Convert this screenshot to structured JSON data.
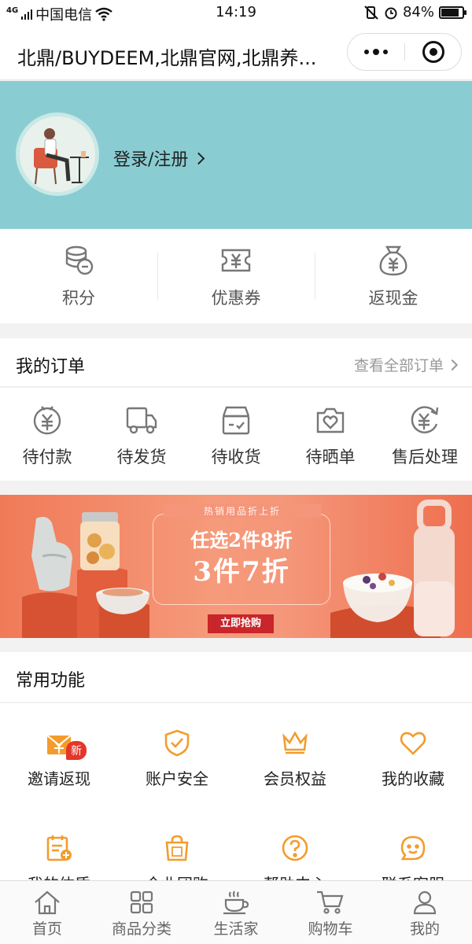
{
  "status_bar": {
    "network": "4G",
    "carrier": "中国电信",
    "time": "14:19",
    "battery_text": "84%",
    "battery_level": 0.84
  },
  "title_bar": {
    "title": "北鼎/BUYDEEM,北鼎官网,北鼎养..."
  },
  "profile": {
    "login_label": "登录/注册",
    "bg_color": "#89cdd3"
  },
  "wallet": [
    {
      "label": "积分",
      "icon": "coins-icon"
    },
    {
      "label": "优惠券",
      "icon": "coupon-icon"
    },
    {
      "label": "返现金",
      "icon": "money-bag-icon"
    }
  ],
  "orders": {
    "title": "我的订单",
    "view_all": "查看全部订单",
    "items": [
      {
        "label": "待付款",
        "icon": "yen-circle-icon"
      },
      {
        "label": "待发货",
        "icon": "truck-icon"
      },
      {
        "label": "待收货",
        "icon": "box-icon"
      },
      {
        "label": "待晒单",
        "icon": "camera-heart-icon"
      },
      {
        "label": "售后处理",
        "icon": "refund-icon"
      }
    ]
  },
  "banner": {
    "tagline": "热销用品折上折",
    "line1": "任选2件8折",
    "line2": "3件7折",
    "button": "立即抢购"
  },
  "functions": {
    "title": "常用功能",
    "accent_color": "#f39c2c",
    "items": [
      {
        "label": "邀请返现",
        "icon": "invite-gift-icon",
        "badge": "新"
      },
      {
        "label": "账户安全",
        "icon": "shield-check-icon"
      },
      {
        "label": "会员权益",
        "icon": "crown-icon"
      },
      {
        "label": "我的收藏",
        "icon": "heart-icon"
      },
      {
        "label": "我的体质",
        "icon": "notepad-plus-icon"
      },
      {
        "label": "企业团购",
        "icon": "shopping-bag-icon"
      },
      {
        "label": "帮助中心",
        "icon": "question-icon"
      },
      {
        "label": "联系客服",
        "icon": "chat-face-icon"
      }
    ]
  },
  "tab_bar": [
    {
      "label": "首页",
      "icon": "home-icon"
    },
    {
      "label": "商品分类",
      "icon": "grid-icon"
    },
    {
      "label": "生活家",
      "icon": "coffee-cup-icon"
    },
    {
      "label": "购物车",
      "icon": "cart-icon"
    },
    {
      "label": "我的",
      "icon": "person-icon"
    }
  ]
}
